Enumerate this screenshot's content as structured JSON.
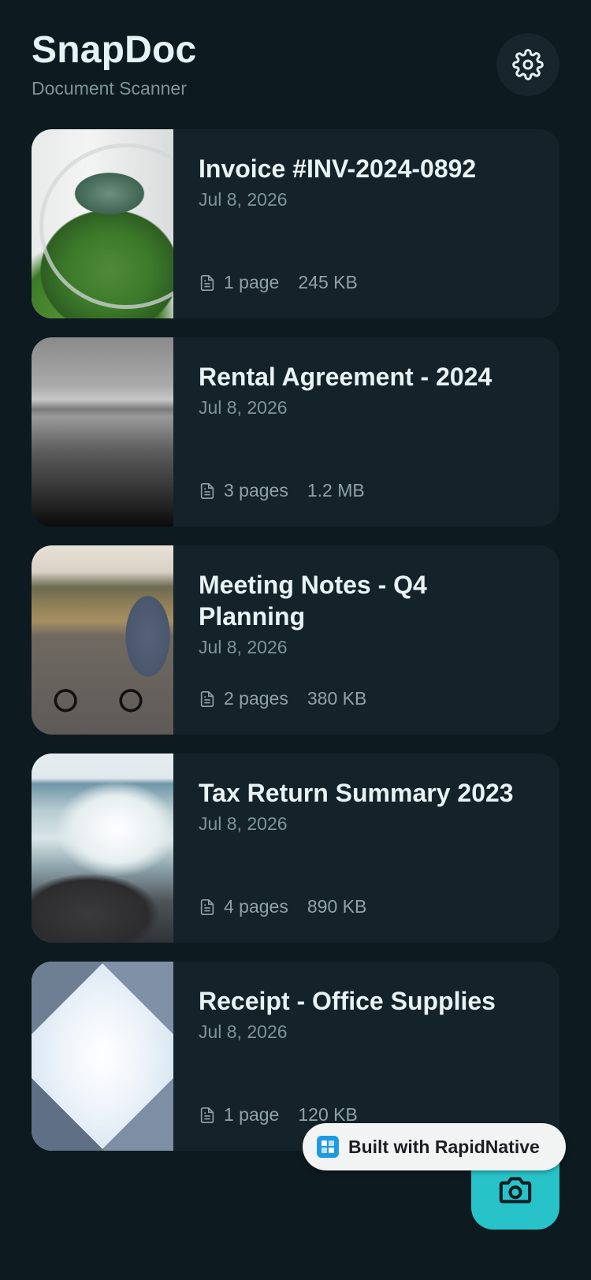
{
  "header": {
    "title": "SnapDoc",
    "subtitle": "Document Scanner",
    "settings_icon": "gear-icon"
  },
  "documents": [
    {
      "title": "Invoice #INV-2024-0892",
      "date": "Jul 8, 2026",
      "pages": "1 page",
      "size": "245 KB",
      "thumbnail": "terrarium-plant"
    },
    {
      "title": "Rental Agreement - 2024",
      "date": "Jul 8, 2026",
      "pages": "3 pages",
      "size": "1.2 MB",
      "thumbnail": "grayscale-sea"
    },
    {
      "title": "Meeting Notes - Q4 Planning",
      "date": "Jul 8, 2026",
      "pages": "2 pages",
      "size": "380 KB",
      "thumbnail": "woman-on-bike"
    },
    {
      "title": "Tax Return Summary 2023",
      "date": "Jul 8, 2026",
      "pages": "4 pages",
      "size": "890 KB",
      "thumbnail": "wave-on-rocks"
    },
    {
      "title": "Receipt - Office Supplies",
      "date": "Jul 8, 2026",
      "pages": "1 page",
      "size": "120 KB",
      "thumbnail": "sky-between-buildings"
    }
  ],
  "fab": {
    "icon": "camera-icon"
  },
  "badge": {
    "label": "Built with RapidNative"
  },
  "colors": {
    "background": "#0d1a1f",
    "card": "#14232a",
    "accent": "#27c3c8",
    "muted_text": "#7e9499"
  }
}
